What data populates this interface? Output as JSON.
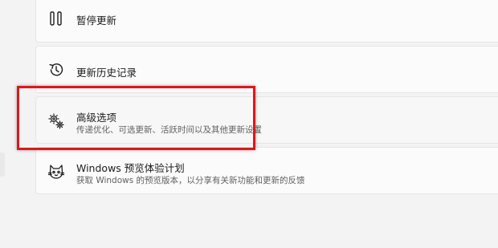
{
  "settings": {
    "items": [
      {
        "title": "暂停更新",
        "icon": "pause-icon"
      },
      {
        "title": "更新历史记录",
        "icon": "history-icon"
      },
      {
        "title": "高级选项",
        "subtitle": "传递优化、可选更新、活跃时间以及其他更新设置",
        "icon": "gears-icon"
      },
      {
        "title": "Windows 预览体验计划",
        "subtitle": "获取 Windows 的预览版本，以分享有关新功能和更新的反馈",
        "icon": "insider-cat-icon"
      }
    ]
  },
  "colors": {
    "highlight": "#e0161c",
    "background": "#f3f3f3",
    "card": "#fbfbfb"
  }
}
